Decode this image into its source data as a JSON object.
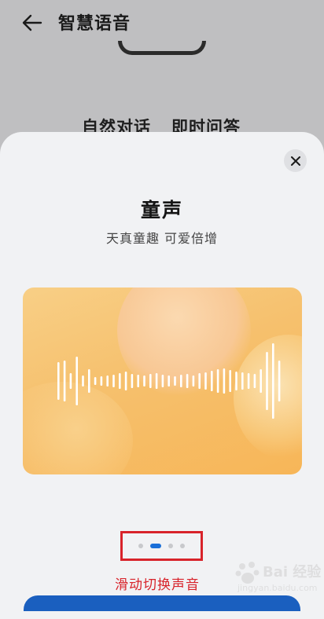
{
  "header": {
    "title": "智慧语音"
  },
  "background": {
    "tab_left": "自然对话",
    "tab_right": "即时问答"
  },
  "sheet": {
    "voice_name": "童声",
    "voice_desc": "天真童趣 可爱倍增",
    "pager": {
      "total": 4,
      "active_index": 1
    },
    "caption": "滑动切换声音"
  },
  "watermark": {
    "text": "Bai 经验",
    "sub": "jingyan.baidu.com"
  },
  "colors": {
    "accent": "#1a6fd8",
    "highlight": "#d8232a",
    "card": "#f6c06d"
  },
  "icons": {
    "back": "arrow-left-icon",
    "close": "close-icon"
  }
}
